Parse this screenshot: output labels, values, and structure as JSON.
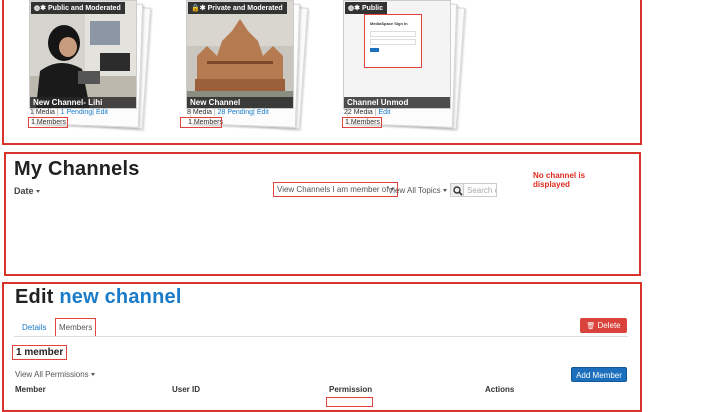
{
  "channels": [
    {
      "badge": "Public and Moderated",
      "badge_icon": "globe-gear-icon",
      "title": "New Channel- Lihi",
      "media": "1 Media",
      "pending": "1 Pending",
      "edit": "Edit",
      "members": "1 Members"
    },
    {
      "badge": "Private and Moderated",
      "badge_icon": "lock-gear-icon",
      "title": "New Channel",
      "media": "8 Media",
      "pending": "28 Pending",
      "edit": "Edit",
      "members": "1 Members"
    },
    {
      "badge": "Public",
      "badge_icon": "globe-gear-icon",
      "title": "Channel Unmod",
      "media": "22 Media",
      "pending": "",
      "edit": "Edit",
      "members": "1 Members",
      "thumb_text": "MediaSpace Sign In"
    }
  ],
  "my_channels": {
    "title": "My Channels",
    "sort_label": "Date",
    "filter_label": "View Channels I am member of",
    "topics_label": "View All Topics",
    "search_placeholder": "Search c",
    "note": "No channel is displayed"
  },
  "edit_channel": {
    "title_prefix": "Edit",
    "title_name": "new channel",
    "tabs": [
      "Details",
      "Members"
    ],
    "delete_label": "Delete",
    "member_count": "1 member",
    "permissions_filter": "View All Permissions",
    "add_member_label": "Add Member",
    "columns": [
      "Member",
      "User ID",
      "Permission",
      "Actions"
    ]
  },
  "colors": {
    "accent_red": "#d9342b",
    "link_blue": "#1a7bc9",
    "delete_red": "#d9433b",
    "add_blue": "#1b6fbd"
  }
}
